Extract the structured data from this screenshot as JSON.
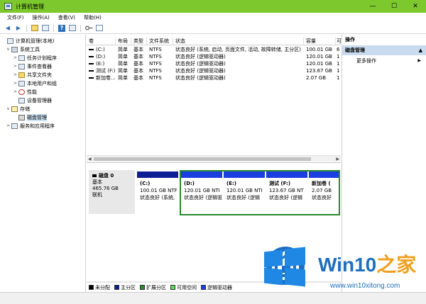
{
  "window": {
    "title": "计算机管理",
    "controls": {
      "minimize": "—",
      "maximize": "☐",
      "close": "✕"
    }
  },
  "menu": [
    "文件(F)",
    "操作(A)",
    "查看(V)",
    "帮助(H)"
  ],
  "toolbar": {
    "back_icon": "◀",
    "forward_icon": "▶",
    "help_icon": "?"
  },
  "tree": [
    {
      "label": "计算机管理(本地)",
      "twisty": "",
      "level": 0,
      "icon": "computer-icon"
    },
    {
      "label": "系统工具",
      "twisty": "∨",
      "level": 1,
      "icon": "tools-icon"
    },
    {
      "label": "任务计划程序",
      "twisty": ">",
      "level": 2,
      "icon": "task-scheduler-icon"
    },
    {
      "label": "事件查看器",
      "twisty": ">",
      "level": 2,
      "icon": "event-viewer-icon"
    },
    {
      "label": "共享文件夹",
      "twisty": ">",
      "level": 2,
      "icon": "shared-folder-icon"
    },
    {
      "label": "本地用户和组",
      "twisty": ">",
      "level": 2,
      "icon": "users-icon"
    },
    {
      "label": "性能",
      "twisty": ">",
      "level": 2,
      "icon": "performance-icon"
    },
    {
      "label": "设备管理器",
      "twisty": "",
      "level": 2,
      "icon": "device-manager-icon"
    },
    {
      "label": "存储",
      "twisty": "∨",
      "level": 1,
      "icon": "storage-icon"
    },
    {
      "label": "磁盘管理",
      "twisty": "",
      "level": 2,
      "icon": "disk-icon",
      "selected": true
    },
    {
      "label": "服务和应用程序",
      "twisty": ">",
      "level": 1,
      "icon": "services-icon"
    }
  ],
  "volume_list": {
    "headers": [
      "卷",
      "布局",
      "类型",
      "文件系统",
      "状态",
      "容量",
      "可"
    ],
    "rows": [
      [
        "(C:)",
        "简单",
        "基本",
        "NTFS",
        "状态良好 (系统, 启动, 页面文件, 活动, 故障转储, 主分区)",
        "100.01 GB",
        "6"
      ],
      [
        "(D:)",
        "简单",
        "基本",
        "NTFS",
        "状态良好 (逻辑驱动器)",
        "120.01 GB",
        "1"
      ],
      [
        "(E:)",
        "简单",
        "基本",
        "NTFS",
        "状态良好 (逻辑驱动器)",
        "120.01 GB",
        "1"
      ],
      [
        "测试 (F:)",
        "简单",
        "基本",
        "NTFS",
        "状态良好 (逻辑驱动器)",
        "123.67 GB",
        "1"
      ],
      [
        "新加卷...",
        "简单",
        "基本",
        "NTFS",
        "状态良好 (逻辑驱动器)",
        "2.07 GB",
        "1"
      ]
    ]
  },
  "disk": {
    "name": "磁盘 0",
    "type": "基本",
    "size": "465.76 GB",
    "status": "联机",
    "partitions": [
      {
        "label": "(C:)",
        "size": "100.01 GB NTF",
        "status": "状态良好 (系统,",
        "kind": "primary"
      },
      {
        "label": "(D:)",
        "size": "120.01 GB NTI",
        "status": "状态良好 (逻辑驱",
        "kind": "logical"
      },
      {
        "label": "(E:)",
        "size": "120.01 GB NTI",
        "status": "状态良好 (逻辑",
        "kind": "logical"
      },
      {
        "label": "测试  (F:)",
        "size": "123.67 GB NT",
        "status": "状态良好 (逻辑",
        "kind": "logical"
      },
      {
        "label": "新加卷  (",
        "size": "2.07 GB",
        "status": "状态良好",
        "kind": "logical"
      }
    ]
  },
  "legend": [
    {
      "label": "未分配",
      "color": "#000000"
    },
    {
      "label": "主分区",
      "color": "#0d1f95"
    },
    {
      "label": "扩展分区",
      "color": "#2a8a2a"
    },
    {
      "label": "可用空间",
      "color": "#55dd55"
    },
    {
      "label": "逻辑驱动器",
      "color": "#1a3ee0"
    }
  ],
  "actions": {
    "title": "操作",
    "group": "磁盘管理",
    "item": "更多操作"
  },
  "watermark": {
    "brand": "Win10",
    "brand_accent": "之家",
    "url": "www.win10xitong.com"
  },
  "colors": {
    "titlebar": "#7cc82d",
    "primary_partition": "#0d1f95",
    "logical_drive": "#1a3ee0",
    "extended_frame": "#2a8a2a",
    "action_group": "#c9dcef"
  }
}
